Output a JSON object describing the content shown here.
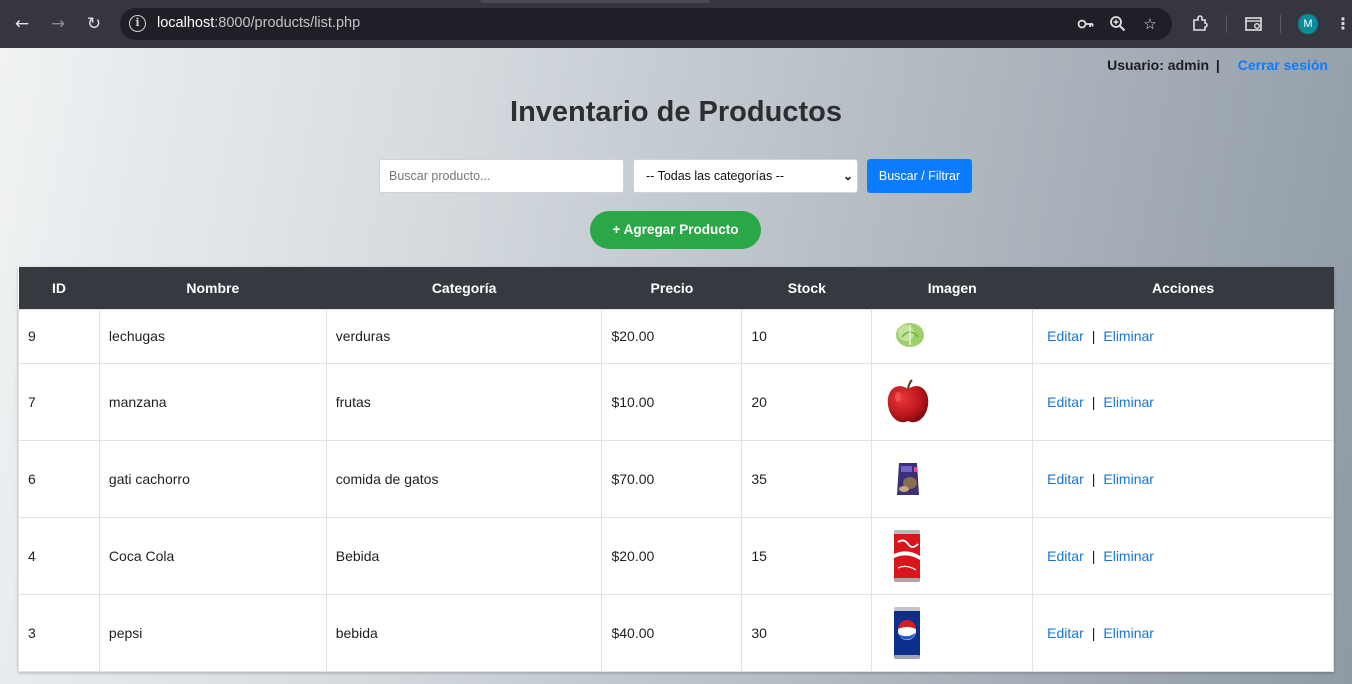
{
  "browser": {
    "url_host": "localhost",
    "url_path": ":8000/products/list.php",
    "avatar_letter": "M"
  },
  "header": {
    "user_label": "Usuario: admin",
    "separator": "|",
    "logout_label": "Cerrar sesión"
  },
  "page": {
    "title": "Inventario de Productos"
  },
  "filters": {
    "search_placeholder": "Buscar producto...",
    "category_selected": "-- Todas las categorías --",
    "submit_label": "Buscar / Filtrar"
  },
  "actions": {
    "add_label": "+ Agregar Producto"
  },
  "table": {
    "columns": [
      "ID",
      "Nombre",
      "Categoría",
      "Precio",
      "Stock",
      "Imagen",
      "Acciones"
    ],
    "rows": [
      {
        "id": "9",
        "name": "lechugas",
        "category": "verduras",
        "price": "$20.00",
        "stock": "10",
        "image_icon": "lettuce-image",
        "edit": "Editar",
        "delete": "Eliminar"
      },
      {
        "id": "7",
        "name": "manzana",
        "category": "frutas",
        "price": "$10.00",
        "stock": "20",
        "image_icon": "apple-image",
        "edit": "Editar",
        "delete": "Eliminar"
      },
      {
        "id": "6",
        "name": "gati cachorro",
        "category": "comida de gatos",
        "price": "$70.00",
        "stock": "35",
        "image_icon": "cat-food-bag-image",
        "edit": "Editar",
        "delete": "Eliminar"
      },
      {
        "id": "4",
        "name": "Coca Cola",
        "category": "Bebida",
        "price": "$20.00",
        "stock": "15",
        "image_icon": "coca-cola-can-image",
        "edit": "Editar",
        "delete": "Eliminar"
      },
      {
        "id": "3",
        "name": "pepsi",
        "category": "bebida",
        "price": "$40.00",
        "stock": "30",
        "image_icon": "pepsi-can-image",
        "edit": "Editar",
        "delete": "Eliminar"
      }
    ]
  },
  "colors": {
    "header_bg": "#343a40",
    "primary": "#0b7cff",
    "success": "#2aa848",
    "link": "#1675d6"
  }
}
